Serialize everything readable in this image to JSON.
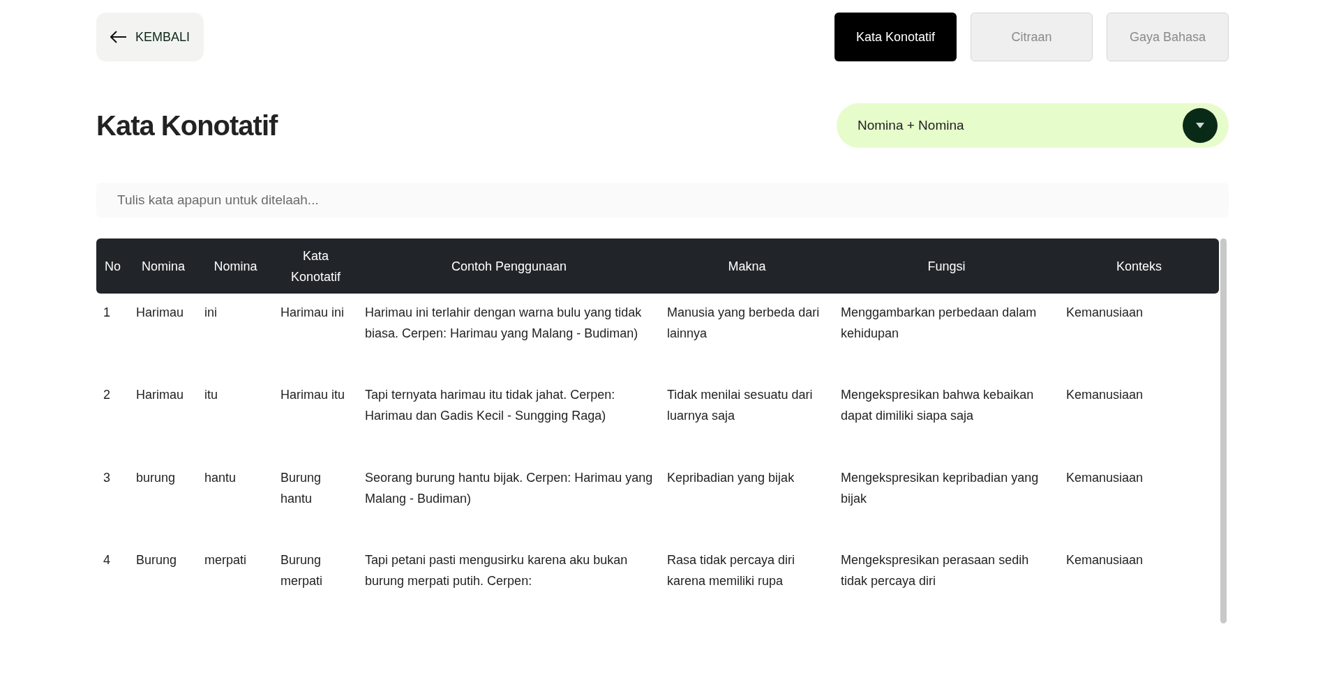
{
  "back_button": {
    "label": "KEMBALI"
  },
  "tabs": [
    {
      "label": "Kata Konotatif",
      "selected": true
    },
    {
      "label": "Citraan",
      "selected": false
    },
    {
      "label": "Gaya Bahasa",
      "selected": false
    }
  ],
  "page_title": "Kata Konotatif",
  "dropdown": {
    "value": "Nomina + Nomina"
  },
  "search": {
    "placeholder": "Tulis kata apapun untuk ditelaah..."
  },
  "table": {
    "columns": [
      "No",
      "Nomina",
      "Nomina",
      "Kata Konotatif",
      "Contoh Penggunaan",
      "Makna",
      "Fungsi",
      "Konteks"
    ],
    "rows": [
      [
        "1",
        "Harimau",
        "ini",
        "Harimau ini",
        "Harimau ini terlahir dengan warna bulu yang tidak biasa. Cerpen: Harimau yang Malang - Budiman)",
        "Manusia yang berbeda dari lainnya",
        "Menggambarkan perbedaan dalam kehidupan",
        "Kemanusiaan"
      ],
      [
        "2",
        "Harimau",
        "itu",
        "Harimau itu",
        "Tapi ternyata harimau itu tidak jahat. Cerpen: Harimau dan Gadis Kecil - Sungging Raga)",
        "Tidak menilai sesuatu dari luarnya saja",
        "Mengekspresikan bahwa kebaikan dapat dimiliki siapa saja",
        "Kemanusiaan"
      ],
      [
        "3",
        "burung",
        "hantu",
        "Burung hantu",
        "Seorang burung hantu bijak. Cerpen: Harimau yang Malang - Budiman)",
        "Kepribadian yang bijak",
        "Mengekspresikan kepribadian yang bijak",
        "Kemanusiaan"
      ],
      [
        "4",
        "Burung",
        "merpati",
        "Burung merpati",
        "Tapi petani pasti mengusirku karena aku bukan burung merpati putih. Cerpen:",
        "Rasa tidak percaya diri karena memiliki rupa",
        "Mengekspresikan perasaan sedih tidak percaya diri",
        "Kemanusiaan"
      ]
    ]
  }
}
